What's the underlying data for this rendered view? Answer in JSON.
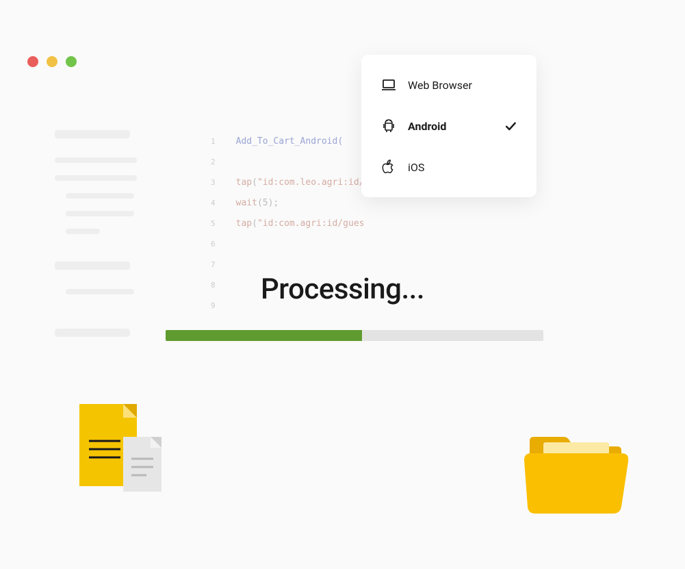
{
  "platform_selector": {
    "options": [
      {
        "label": "Web Browser",
        "icon": "laptop-icon",
        "selected": false
      },
      {
        "label": "Android",
        "icon": "android-icon",
        "selected": true
      },
      {
        "label": "iOS",
        "icon": "apple-icon",
        "selected": false
      }
    ]
  },
  "code": {
    "line_count": 9,
    "lines": [
      {
        "type": "fn",
        "text": "Add_To_Cart_Android("
      },
      {
        "type": "empty",
        "text": ""
      },
      {
        "type": "tap",
        "prefix": "tap",
        "arg": "\"id:com.leo.agri:id/c"
      },
      {
        "type": "wait",
        "prefix": "wait",
        "arg": "(5);"
      },
      {
        "type": "tap",
        "prefix": "tap",
        "arg": "\"id:com.agri:id/gues"
      },
      {
        "type": "empty",
        "text": ""
      },
      {
        "type": "empty",
        "text": ""
      },
      {
        "type": "empty",
        "text": ""
      },
      {
        "type": "empty",
        "text": ""
      }
    ]
  },
  "processing": {
    "title": "Processing...",
    "progress_percent": 52
  },
  "colors": {
    "progress_fill": "#5f9b2f",
    "progress_track": "#e3e3e3",
    "traffic_red": "#e95e5a",
    "traffic_yellow": "#f0c144",
    "traffic_green": "#73c44a",
    "folder_yellow": "#fabf00",
    "folder_accent": "#e8ac03",
    "doc_yellow": "#f5c400",
    "doc_gray": "#e6e6e6"
  }
}
